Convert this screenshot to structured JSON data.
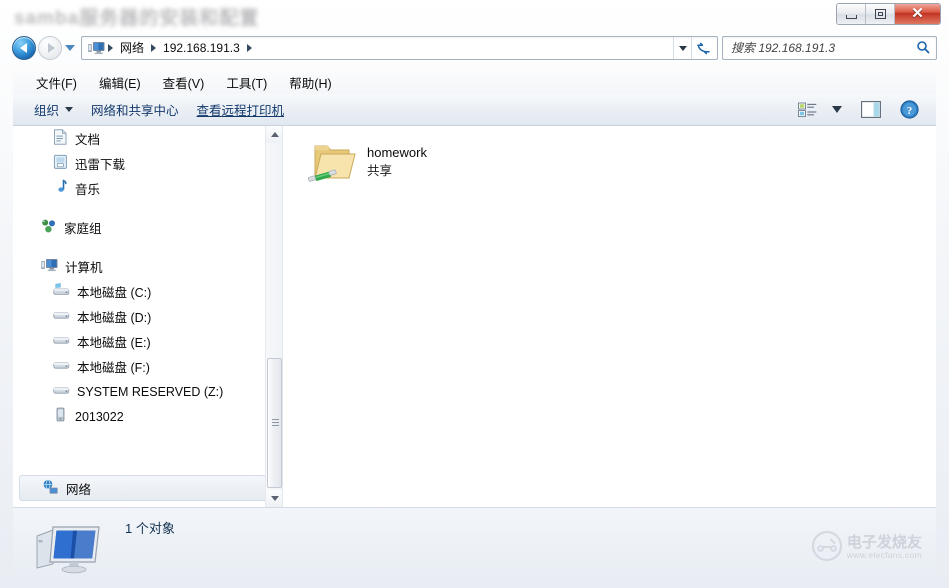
{
  "window": {
    "title": "samba服务器的安装和配置",
    "controls": {
      "minimize": "最小化",
      "maximize": "最大化",
      "close": "✕"
    }
  },
  "navbar": {
    "back_tooltip": "后退",
    "forward_tooltip": "前进",
    "history_tooltip": "最近访问的位置",
    "refresh_label": "↻",
    "breadcrumb": [
      {
        "label": "网络"
      },
      {
        "label": "192.168.191.3"
      }
    ],
    "search": {
      "placeholder": "搜索 192.168.191.3",
      "icon": "search-icon"
    }
  },
  "menubar": {
    "items": [
      {
        "label": "文件(F)"
      },
      {
        "label": "编辑(E)"
      },
      {
        "label": "查看(V)"
      },
      {
        "label": "工具(T)"
      },
      {
        "label": "帮助(H)"
      }
    ]
  },
  "toolbar": {
    "organize_label": "组织",
    "network_sharing_center_label": "网络和共享中心",
    "remote_printers_label": "查看远程打印机",
    "view_icon": "view-options-icon",
    "preview_icon": "preview-pane-icon",
    "help_icon": "help-icon"
  },
  "sidebar": {
    "items": [
      {
        "label": "文档",
        "icon": "document-icon",
        "indent": 2
      },
      {
        "label": "迅雷下载",
        "icon": "downloads-icon",
        "indent": 2
      },
      {
        "label": "音乐",
        "icon": "music-icon",
        "indent": 2
      },
      {
        "label": "家庭组",
        "icon": "homegroup-icon",
        "indent": 1
      },
      {
        "label": "计算机",
        "icon": "computer-icon",
        "indent": 1
      },
      {
        "label": "本地磁盘 (C:)",
        "icon": "system-drive-icon",
        "indent": 2
      },
      {
        "label": "本地磁盘 (D:)",
        "icon": "drive-icon",
        "indent": 2
      },
      {
        "label": "本地磁盘 (E:)",
        "icon": "drive-icon",
        "indent": 2
      },
      {
        "label": "本地磁盘 (F:)",
        "icon": "drive-icon",
        "indent": 2
      },
      {
        "label": "SYSTEM RESERVED (Z:)",
        "icon": "drive-icon",
        "indent": 2
      },
      {
        "label": "2013022",
        "icon": "portable-device-icon",
        "indent": 2
      }
    ],
    "network_item": {
      "label": "网络",
      "icon": "network-icon",
      "selected": true
    }
  },
  "content": {
    "items": [
      {
        "name": "homework",
        "subtitle": "共享",
        "icon": "shared-folder-icon"
      }
    ]
  },
  "statusbar": {
    "text": "1 个对象",
    "icon": "computer-icon"
  },
  "watermark": {
    "cn": "电子发烧友",
    "url": "www.elecfans.com"
  },
  "colors": {
    "accent_blue": "#1766b0",
    "close_red": "#c33222",
    "folder_yellow": "#f5d98b",
    "share_green": "#2faa4a",
    "link_blue": "#14396b"
  }
}
